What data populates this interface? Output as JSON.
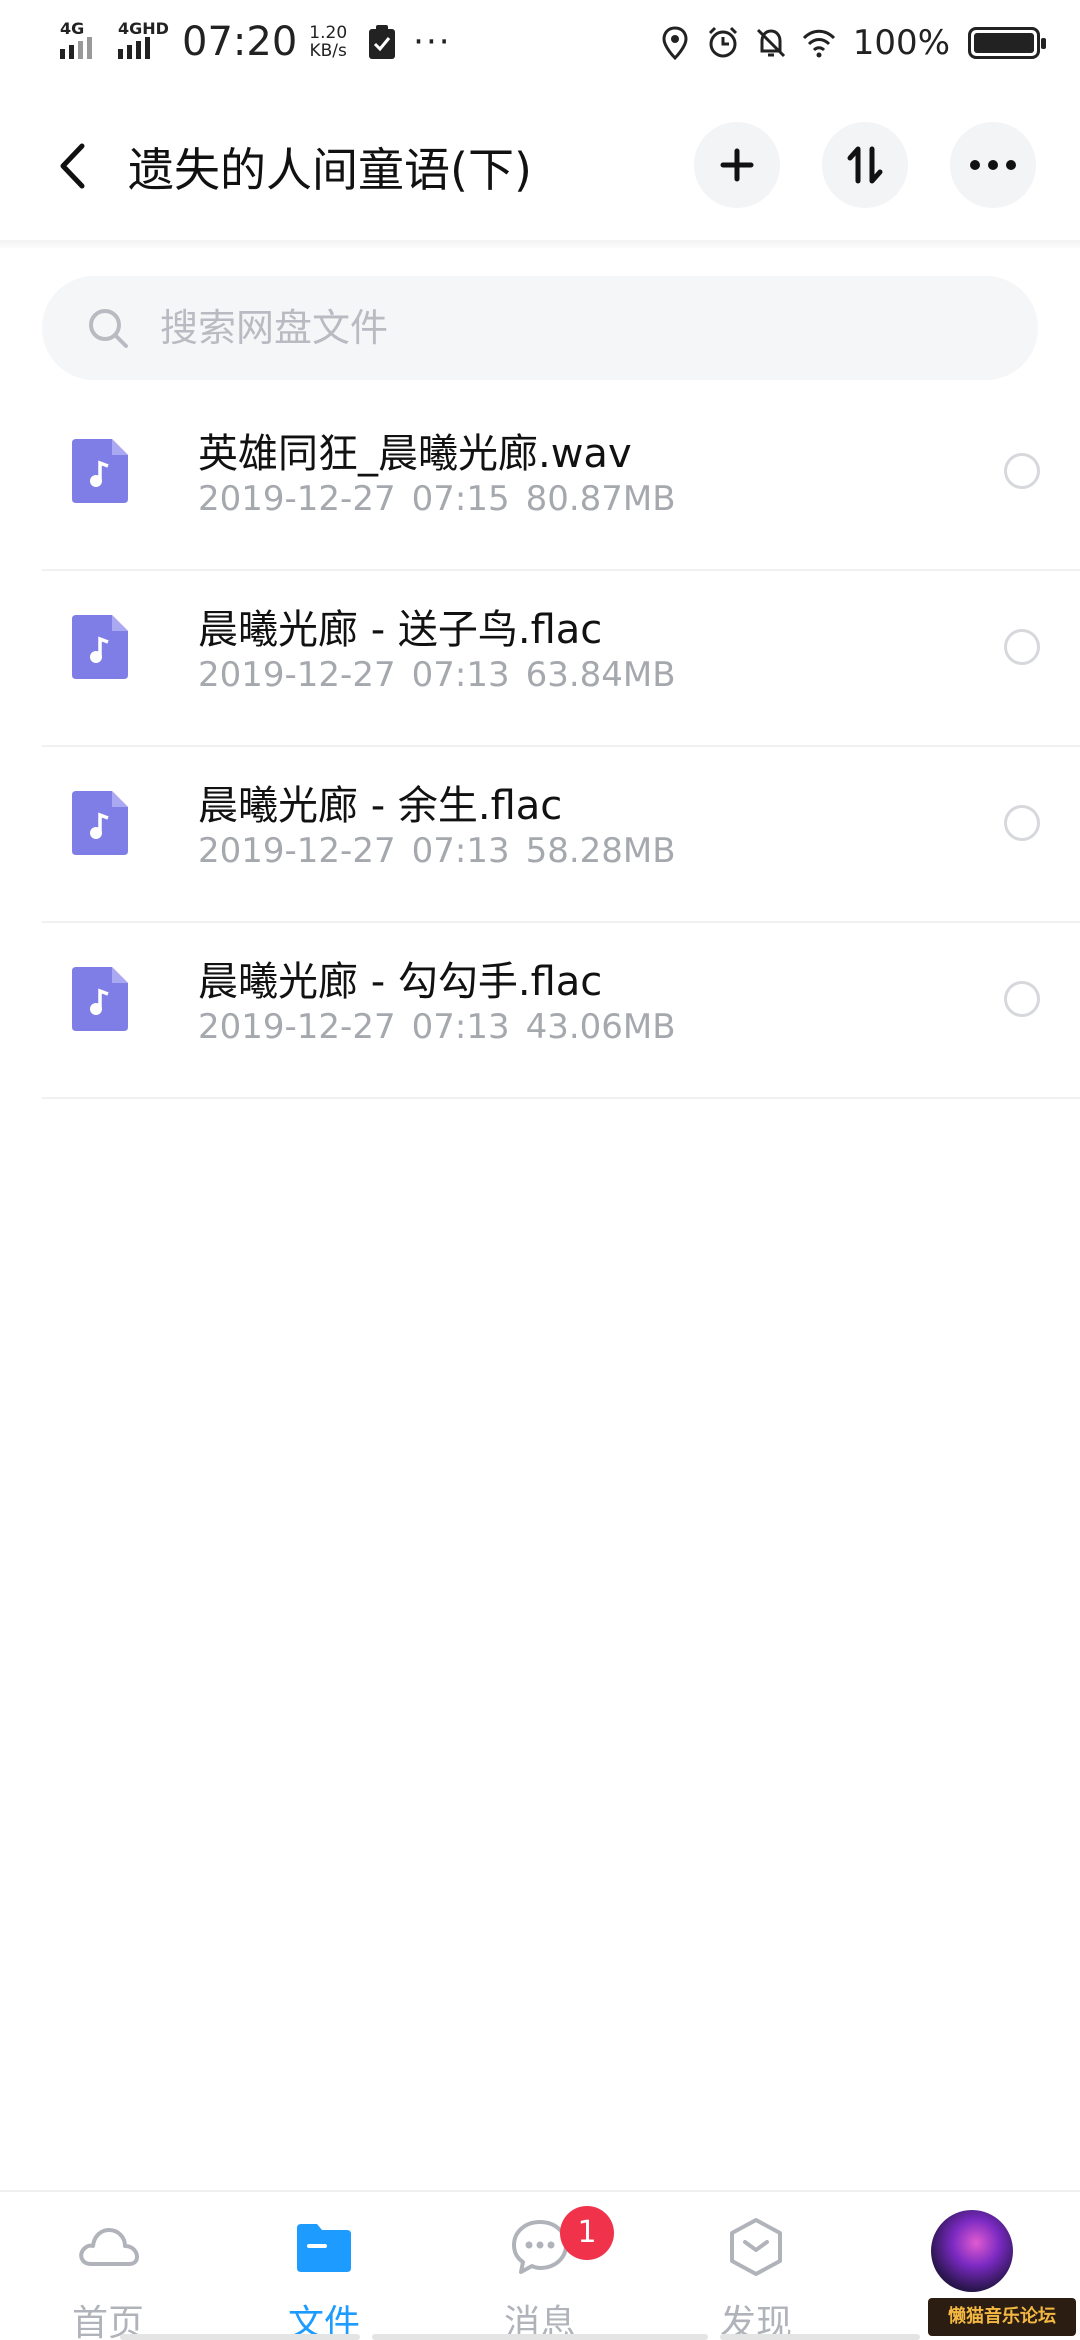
{
  "status_bar": {
    "signal1_label": "4G",
    "signal2_label": "4GHD",
    "time": "07:20",
    "speed_value": "1.20",
    "speed_unit": "KB/s",
    "more": "···",
    "battery_percent": "100%"
  },
  "header": {
    "title": "遗失的人间童语(下)",
    "icons": [
      "back-arrow",
      "plus",
      "sort-arrows",
      "more-dots"
    ]
  },
  "search": {
    "placeholder": "搜索网盘文件"
  },
  "files": [
    {
      "name": "英雄同狂_晨曦光廊.wav",
      "date": "2019-12-27",
      "time": "07:15",
      "size": "80.87MB"
    },
    {
      "name": "晨曦光廊 - 送子鸟.flac",
      "date": "2019-12-27",
      "time": "07:13",
      "size": "63.84MB"
    },
    {
      "name": "晨曦光廊 - 余生.flac",
      "date": "2019-12-27",
      "time": "07:13",
      "size": "58.28MB"
    },
    {
      "name": "晨曦光廊 - 勾勾手.flac",
      "date": "2019-12-27",
      "time": "07:13",
      "size": "43.06MB"
    }
  ],
  "tabbar": {
    "tabs": [
      {
        "label": "首页",
        "icon": "cloud-icon",
        "active": false
      },
      {
        "label": "文件",
        "icon": "folder-icon",
        "active": true
      },
      {
        "label": "消息",
        "icon": "chat-icon",
        "active": false,
        "badge": "1"
      },
      {
        "label": "发现",
        "icon": "cube-icon",
        "active": false
      },
      {
        "label": "",
        "icon": "avatar",
        "active": false
      }
    ],
    "watermark": "懒猫音乐论坛"
  },
  "colors": {
    "accent": "#1e9bff",
    "file_icon": "#7f7ee6",
    "badge": "#f0334b",
    "muted_text": "#a5a9ae"
  }
}
